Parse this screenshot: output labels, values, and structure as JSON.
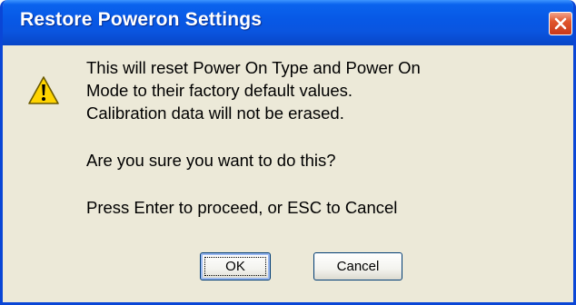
{
  "dialog": {
    "title": "Restore Poweron Settings",
    "message_lines": [
      "This will reset Power On Type and Power On",
      "Mode to their factory default values.",
      "Calibration data will not be erased."
    ],
    "question": "Are you sure you want to do this?",
    "instruction": "Press Enter to proceed, or ESC to Cancel",
    "ok_label": "OK",
    "cancel_label": "Cancel",
    "icon": "warning-icon",
    "close_icon": "close-icon"
  },
  "colors": {
    "titlebar": "#0858e5",
    "window_bg": "#ece9d8",
    "close_button": "#e0562c",
    "warning_yellow": "#ffd400"
  }
}
